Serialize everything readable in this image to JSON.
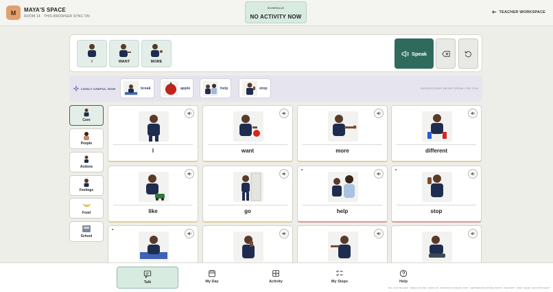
{
  "header": {
    "avatar_initial": "M",
    "space_name": "MAYA'S SPACE",
    "room_line": "ROOM 14 · THIS-BROWSER SYNC ON",
    "schedule_label": "SCHEDULE",
    "schedule_value": "NO ACTIVITY NOW",
    "teacher_link": "TEACHER WORKSPACE",
    "teacher_icon": "arrow-left-icon"
  },
  "sentence_strip": {
    "words": [
      "I",
      "WANT",
      "MORE"
    ],
    "speak_label": "Speak",
    "speak_icon": "speaker-icon",
    "backspace_icon": "backspace-icon",
    "reset_icon": "reset-icon"
  },
  "suggestions": {
    "label": "LIKELY USEFUL NOW",
    "icon": "sparkle-icon",
    "items": [
      "break",
      "apple",
      "help",
      "stop"
    ],
    "note": "SUGGESTIONS NEVER SPEAK FOR YOU"
  },
  "categories": [
    {
      "label": "Core",
      "active": true
    },
    {
      "label": "People",
      "active": false
    },
    {
      "label": "Actions",
      "active": false
    },
    {
      "label": "Feelings",
      "active": false
    },
    {
      "label": "Food",
      "active": false
    },
    {
      "label": "School",
      "active": false
    }
  ],
  "tiles": [
    {
      "word": "I"
    },
    {
      "word": "want"
    },
    {
      "word": "more"
    },
    {
      "word": "different"
    },
    {
      "word": "like"
    },
    {
      "word": "go"
    },
    {
      "word": "help"
    },
    {
      "word": "stop"
    },
    {
      "word": ""
    },
    {
      "word": ""
    },
    {
      "word": ""
    },
    {
      "word": ""
    }
  ],
  "bottom_nav": [
    {
      "label": "Talk",
      "icon": "chat-icon",
      "active": true
    },
    {
      "label": "My Day",
      "icon": "calendar-icon",
      "active": false
    },
    {
      "label": "Activity",
      "icon": "grid-icon",
      "active": false
    },
    {
      "label": "My Steps",
      "icon": "checklist-icon",
      "active": false
    },
    {
      "label": "Help",
      "icon": "question-icon",
      "active": false
    }
  ],
  "footer_note": "TELL YOUR TEACHER · SPEECH VOLUME · ALWAYS ON · PROGRAM OF SPECIAL STUDY · CERTIFIED EDUCATIONAL PHOTOS · RECOVERY · FAMILY SHARE · EDUCATOR SELECT",
  "colors": {
    "accent": "#2f6b5c",
    "accent_light": "#d8ebe1",
    "avatar": "#e0a06e",
    "suggest_bg": "#e5e4ef",
    "core_border": "#e2cf98",
    "urgent_border": "#d79a96"
  }
}
